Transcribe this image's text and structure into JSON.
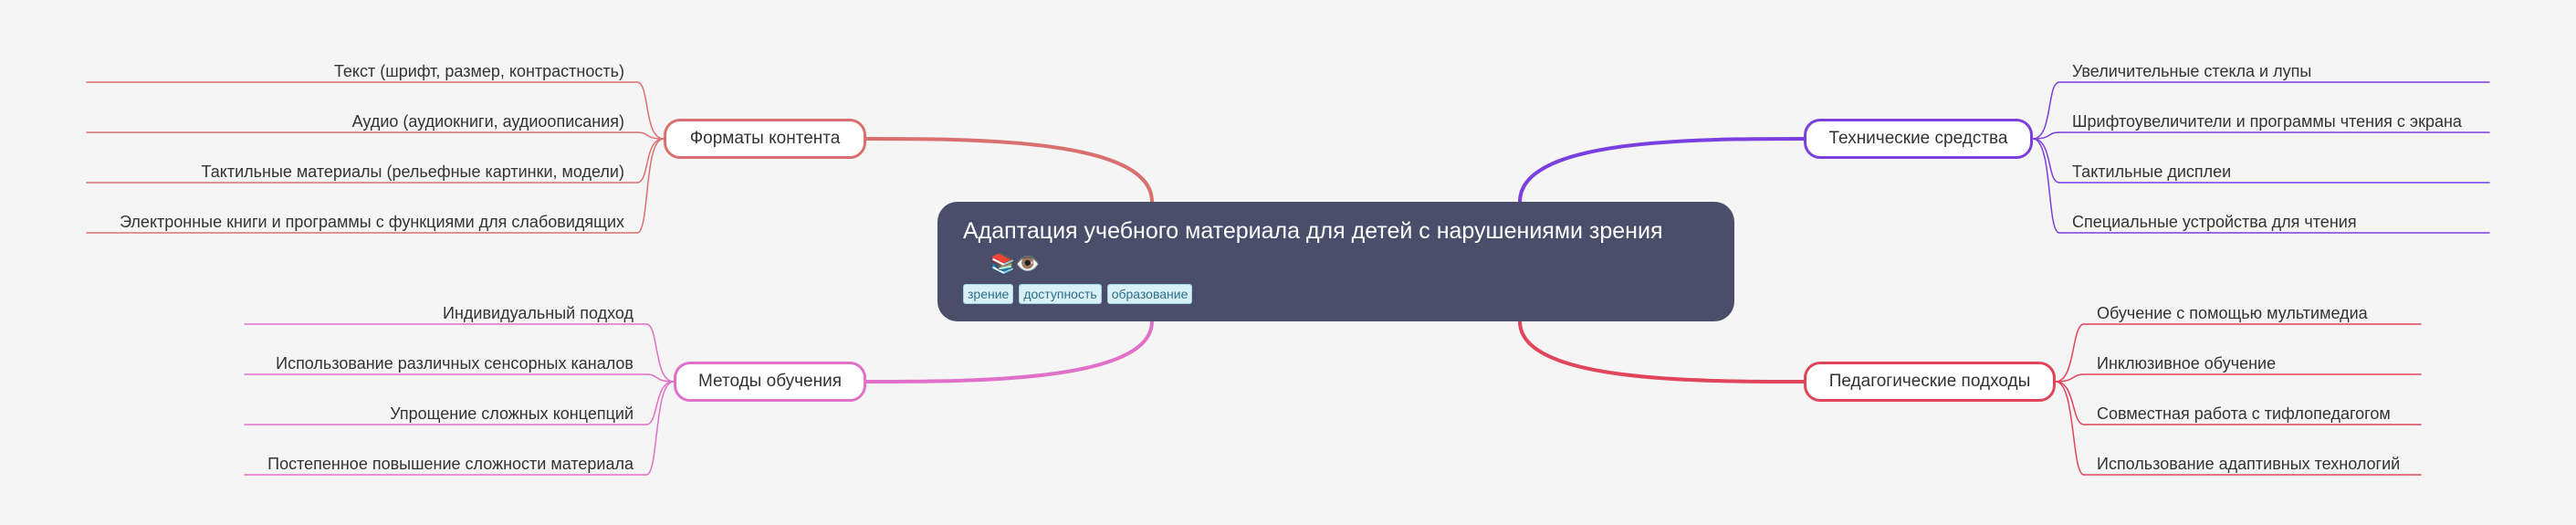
{
  "root": {
    "title": "Адаптация учебного материала для детей с нарушениями зрения",
    "emoji": "📚👁️",
    "tags": [
      "зрение",
      "доступность",
      "образование"
    ]
  },
  "branches": [
    {
      "label": "Форматы контента",
      "color": "#d9706f",
      "leaves": [
        "Текст (шрифт, размер, контрастность)",
        "Аудио (аудиокниги, аудиоописания)",
        "Тактильные материалы (рельефные картинки, модели)",
        "Электронные книги и программы с функциями для слабовидящих"
      ]
    },
    {
      "label": "Методы обучения",
      "color": "#e070c8",
      "leaves": [
        "Индивидуальный подход",
        "Использование различных сенсорных каналов",
        "Упрощение сложных концепций",
        "Постепенное повышение сложности материала"
      ]
    },
    {
      "label": "Технические средства",
      "color": "#7b3fe0",
      "leaves": [
        "Увеличительные стекла и лупы",
        "Шрифтоувеличители и программы чтения с экрана",
        "Тактильные дисплеи",
        "Специальные устройства для чтения"
      ]
    },
    {
      "label": "Педагогические подходы",
      "color": "#e0455a",
      "leaves": [
        "Обучение с помощью мультимедиа",
        "Инклюзивное обучение",
        "Совместная работа с тифлопедагогом",
        "Использование адаптивных технологий"
      ]
    }
  ]
}
